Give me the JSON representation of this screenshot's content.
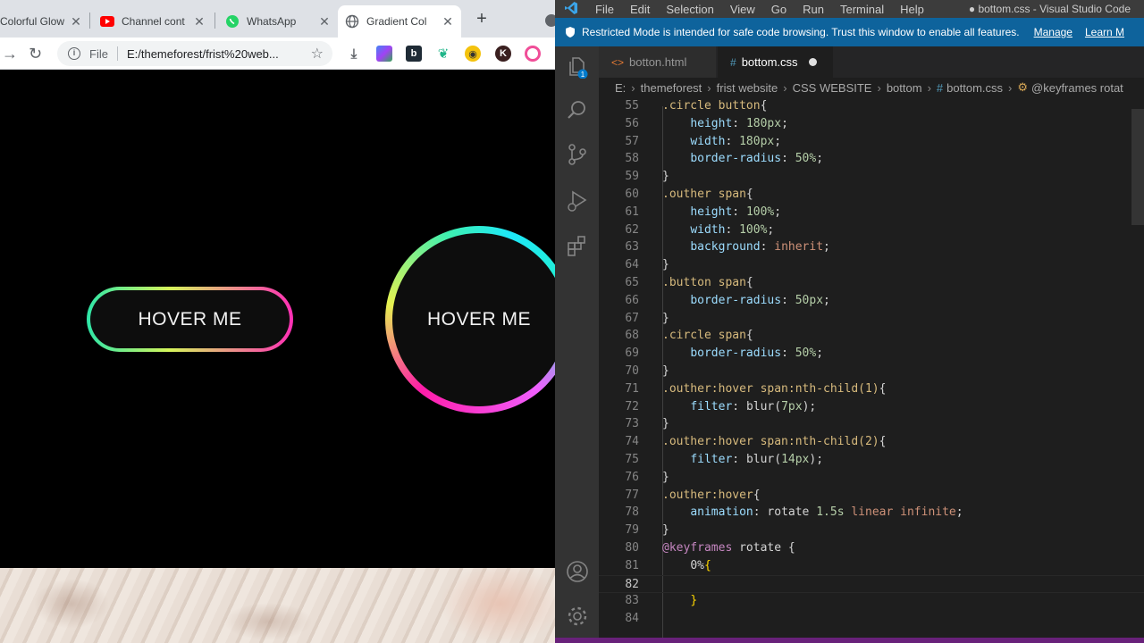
{
  "browser": {
    "tabs": [
      {
        "title": "Colorful Glow",
        "icon": "globe-icon",
        "active": false
      },
      {
        "title": "Channel cont",
        "icon": "youtube-icon",
        "active": false
      },
      {
        "title": "WhatsApp",
        "icon": "whatsapp-icon",
        "active": false
      },
      {
        "title": "Gradient Col",
        "icon": "globe-icon",
        "active": true
      }
    ],
    "tab_close_glyph": "✕",
    "new_tab_glyph": "+",
    "nav": {
      "back": "→",
      "reload": "↻"
    },
    "omnibox": {
      "scheme_label": "File",
      "url": "E:/themeforest/frist%20web...",
      "info_glyph": "i"
    },
    "extensions": [
      "download-icon",
      "extension-square-icon",
      "b-extension-icon",
      "leaf-extension-icon",
      "owl-extension-icon",
      "k-profile-icon",
      "o-extension-icon"
    ],
    "page": {
      "pill_button_label": "HOVER ME",
      "circle_button_label": "HOVER ME",
      "gradient_colors": [
        "#2ee6a8",
        "#d5f55a",
        "#ff2fb5",
        "#1ee8f8"
      ]
    }
  },
  "vscode": {
    "menu": [
      "File",
      "Edit",
      "Selection",
      "View",
      "Go",
      "Run",
      "Terminal",
      "Help"
    ],
    "window_title": "● bottom.css - Visual Studio Code",
    "restricted_banner": {
      "message": "Restricted Mode is intended for safe code browsing. Trust this window to enable all features.",
      "manage_link": "Manage",
      "learn_link": "Learn M"
    },
    "editor_tabs": [
      {
        "label": "botton.html",
        "icon_glyph": "<>",
        "active": false,
        "dirty": false
      },
      {
        "label": "bottom.css",
        "icon_glyph": "#",
        "active": true,
        "dirty": true
      }
    ],
    "breadcrumbs": [
      "E:",
      "themeforest",
      "frist website",
      "CSS  WEBSITE",
      "bottom",
      "bottom.css",
      "@keyframes rotat"
    ],
    "activity_icons": [
      "explorer-icon",
      "search-icon",
      "source-control-icon",
      "run-debug-icon",
      "extensions-icon",
      "accounts-icon",
      "manage-gear-icon"
    ],
    "explorer_badge": "1",
    "code_lines": [
      {
        "n": "55",
        "tokens": [
          {
            "t": ".circle button",
            "c": "sel"
          },
          {
            "t": "{",
            "c": ""
          }
        ]
      },
      {
        "n": "56",
        "tokens": [
          {
            "t": "    ",
            "c": ""
          },
          {
            "t": "height",
            "c": "prop"
          },
          {
            "t": ": ",
            "c": ""
          },
          {
            "t": "180px",
            "c": "num"
          },
          {
            "t": ";",
            "c": ""
          }
        ]
      },
      {
        "n": "57",
        "tokens": [
          {
            "t": "    ",
            "c": ""
          },
          {
            "t": "width",
            "c": "prop"
          },
          {
            "t": ": ",
            "c": ""
          },
          {
            "t": "180px",
            "c": "num"
          },
          {
            "t": ";",
            "c": ""
          }
        ]
      },
      {
        "n": "58",
        "tokens": [
          {
            "t": "    ",
            "c": ""
          },
          {
            "t": "border-radius",
            "c": "prop"
          },
          {
            "t": ": ",
            "c": ""
          },
          {
            "t": "50%",
            "c": "num"
          },
          {
            "t": ";",
            "c": ""
          }
        ]
      },
      {
        "n": "59",
        "tokens": [
          {
            "t": "}",
            "c": ""
          }
        ]
      },
      {
        "n": "60",
        "tokens": [
          {
            "t": ".outher span",
            "c": "sel"
          },
          {
            "t": "{",
            "c": ""
          }
        ]
      },
      {
        "n": "61",
        "tokens": [
          {
            "t": "    ",
            "c": ""
          },
          {
            "t": "height",
            "c": "prop"
          },
          {
            "t": ": ",
            "c": ""
          },
          {
            "t": "100%",
            "c": "num"
          },
          {
            "t": ";",
            "c": ""
          }
        ]
      },
      {
        "n": "62",
        "tokens": [
          {
            "t": "    ",
            "c": ""
          },
          {
            "t": "width",
            "c": "prop"
          },
          {
            "t": ": ",
            "c": ""
          },
          {
            "t": "100%",
            "c": "num"
          },
          {
            "t": ";",
            "c": ""
          }
        ]
      },
      {
        "n": "63",
        "tokens": [
          {
            "t": "    ",
            "c": ""
          },
          {
            "t": "background",
            "c": "prop"
          },
          {
            "t": ": ",
            "c": ""
          },
          {
            "t": "inherit",
            "c": "kw"
          },
          {
            "t": ";",
            "c": ""
          }
        ]
      },
      {
        "n": "64",
        "tokens": [
          {
            "t": "}",
            "c": ""
          }
        ]
      },
      {
        "n": "65",
        "tokens": [
          {
            "t": ".button span",
            "c": "sel"
          },
          {
            "t": "{",
            "c": ""
          }
        ]
      },
      {
        "n": "66",
        "tokens": [
          {
            "t": "    ",
            "c": ""
          },
          {
            "t": "border-radius",
            "c": "prop"
          },
          {
            "t": ": ",
            "c": ""
          },
          {
            "t": "50px",
            "c": "num"
          },
          {
            "t": ";",
            "c": ""
          }
        ]
      },
      {
        "n": "67",
        "tokens": [
          {
            "t": "}",
            "c": ""
          }
        ]
      },
      {
        "n": "68",
        "tokens": [
          {
            "t": ".circle span",
            "c": "sel"
          },
          {
            "t": "{",
            "c": ""
          }
        ]
      },
      {
        "n": "69",
        "tokens": [
          {
            "t": "    ",
            "c": ""
          },
          {
            "t": "border-radius",
            "c": "prop"
          },
          {
            "t": ": ",
            "c": ""
          },
          {
            "t": "50%",
            "c": "num"
          },
          {
            "t": ";",
            "c": ""
          }
        ]
      },
      {
        "n": "70",
        "tokens": [
          {
            "t": "}",
            "c": ""
          }
        ]
      },
      {
        "n": "71",
        "tokens": [
          {
            "t": ".outher:hover span:nth-child(1)",
            "c": "sel"
          },
          {
            "t": "{",
            "c": ""
          }
        ]
      },
      {
        "n": "72",
        "tokens": [
          {
            "t": "    ",
            "c": ""
          },
          {
            "t": "filter",
            "c": "prop"
          },
          {
            "t": ": ",
            "c": ""
          },
          {
            "t": "blur(",
            "c": ""
          },
          {
            "t": "7px",
            "c": "num"
          },
          {
            "t": ");",
            "c": ""
          }
        ]
      },
      {
        "n": "73",
        "tokens": [
          {
            "t": "}",
            "c": ""
          }
        ]
      },
      {
        "n": "74",
        "tokens": [
          {
            "t": ".outher:hover span:nth-child(2)",
            "c": "sel"
          },
          {
            "t": "{",
            "c": ""
          }
        ]
      },
      {
        "n": "75",
        "tokens": [
          {
            "t": "    ",
            "c": ""
          },
          {
            "t": "filter",
            "c": "prop"
          },
          {
            "t": ": ",
            "c": ""
          },
          {
            "t": "blur(",
            "c": ""
          },
          {
            "t": "14px",
            "c": "num"
          },
          {
            "t": ");",
            "c": ""
          }
        ]
      },
      {
        "n": "76",
        "tokens": [
          {
            "t": "}",
            "c": ""
          }
        ]
      },
      {
        "n": "77",
        "tokens": [
          {
            "t": ".outher:hover",
            "c": "sel"
          },
          {
            "t": "{",
            "c": ""
          }
        ]
      },
      {
        "n": "78",
        "tokens": [
          {
            "t": "    ",
            "c": ""
          },
          {
            "t": "animation",
            "c": "prop"
          },
          {
            "t": ": ",
            "c": ""
          },
          {
            "t": "rotate ",
            "c": ""
          },
          {
            "t": "1.5s",
            "c": "num"
          },
          {
            "t": " ",
            "c": ""
          },
          {
            "t": "linear infinite",
            "c": "kw"
          },
          {
            "t": ";",
            "c": ""
          }
        ]
      },
      {
        "n": "79",
        "tokens": [
          {
            "t": "}",
            "c": ""
          }
        ]
      },
      {
        "n": "80",
        "tokens": [
          {
            "t": "@keyframes",
            "c": "at"
          },
          {
            "t": " rotate {",
            "c": ""
          }
        ]
      },
      {
        "n": "81",
        "tokens": [
          {
            "t": "    ",
            "c": ""
          },
          {
            "t": "0%",
            "c": ""
          },
          {
            "t": "{",
            "c": "br"
          }
        ]
      },
      {
        "n": "82",
        "tokens": [
          {
            "t": "",
            "c": ""
          }
        ],
        "current": true
      },
      {
        "n": "83",
        "tokens": [
          {
            "t": "    ",
            "c": ""
          },
          {
            "t": "}",
            "c": "br"
          }
        ]
      },
      {
        "n": "84",
        "tokens": [
          {
            "t": "",
            "c": ""
          }
        ]
      }
    ]
  }
}
